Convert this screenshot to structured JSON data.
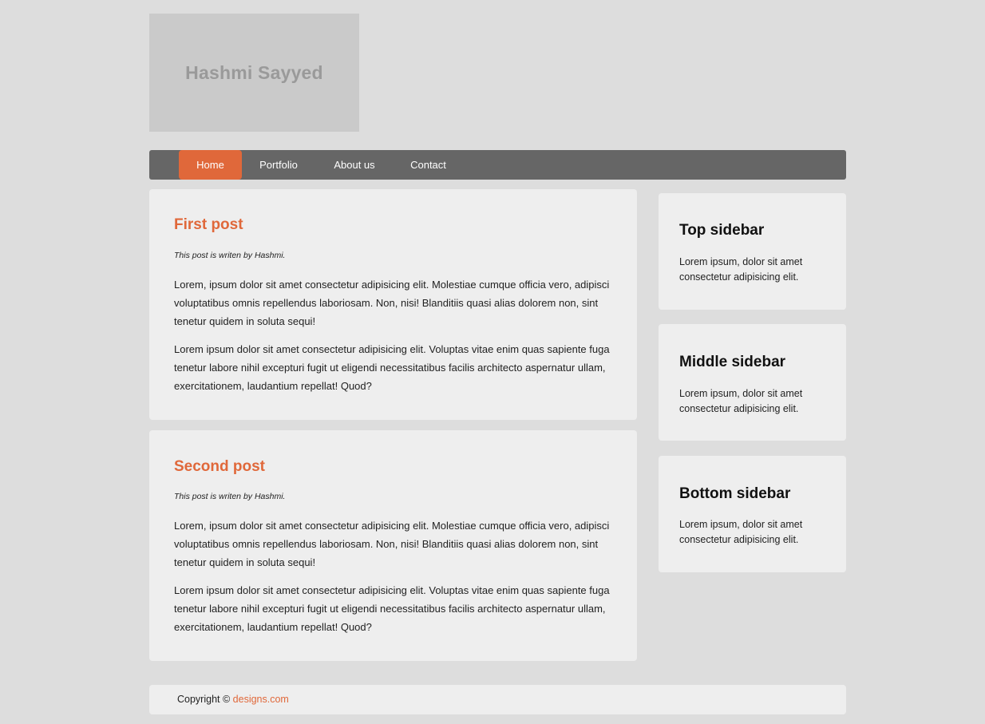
{
  "header": {
    "logo_text": "Hashmi Sayyed"
  },
  "nav": {
    "items": [
      {
        "label": "Home",
        "active": true
      },
      {
        "label": "Portfolio",
        "active": false
      },
      {
        "label": "About us",
        "active": false
      },
      {
        "label": "Contact",
        "active": false
      }
    ]
  },
  "posts": [
    {
      "title": "First post",
      "meta": "This post is writen by Hashmi.",
      "paragraphs": [
        "Lorem, ipsum dolor sit amet consectetur adipisicing elit. Molestiae cumque officia vero, adipisci voluptatibus omnis repellendus laboriosam. Non, nisi! Blanditiis quasi alias dolorem non, sint tenetur quidem in soluta sequi!",
        "Lorem ipsum dolor sit amet consectetur adipisicing elit. Voluptas vitae enim quas sapiente fuga tenetur labore nihil excepturi fugit ut eligendi necessitatibus facilis architecto aspernatur ullam, exercitationem, laudantium repellat! Quod?"
      ]
    },
    {
      "title": "Second post",
      "meta": "This post is writen by Hashmi.",
      "paragraphs": [
        "Lorem, ipsum dolor sit amet consectetur adipisicing elit. Molestiae cumque officia vero, adipisci voluptatibus omnis repellendus laboriosam. Non, nisi! Blanditiis quasi alias dolorem non, sint tenetur quidem in soluta sequi!",
        "Lorem ipsum dolor sit amet consectetur adipisicing elit. Voluptas vitae enim quas sapiente fuga tenetur labore nihil excepturi fugit ut eligendi necessitatibus facilis architecto aspernatur ullam, exercitationem, laudantium repellat! Quod?"
      ]
    }
  ],
  "sidebar": [
    {
      "title": "Top sidebar",
      "text": "Lorem ipsum, dolor sit amet consectetur adipisicing elit."
    },
    {
      "title": "Middle sidebar",
      "text": "Lorem ipsum, dolor sit amet consectetur adipisicing elit."
    },
    {
      "title": "Bottom sidebar",
      "text": "Lorem ipsum, dolor sit amet consectetur adipisicing elit."
    }
  ],
  "footer": {
    "copyright": "Copyright ©",
    "link_text": "designs.com"
  },
  "colors": {
    "accent": "#e0683a",
    "nav_bg": "#666666",
    "page_bg": "#dddddd",
    "card_bg": "#eeeeee"
  }
}
